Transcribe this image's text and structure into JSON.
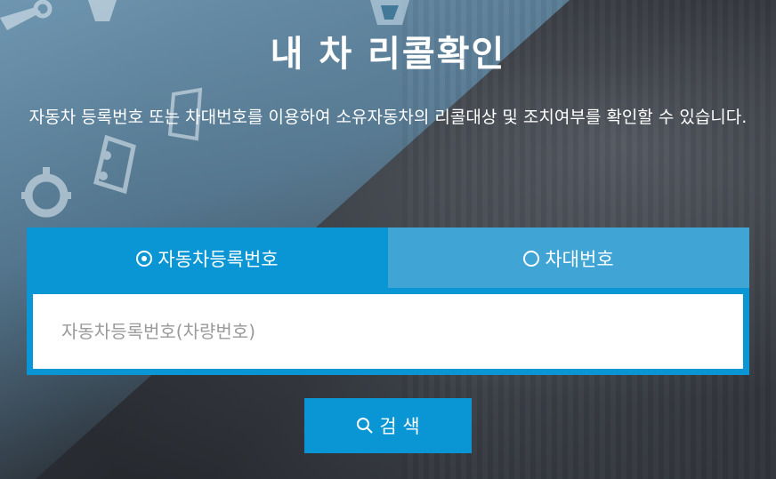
{
  "page": {
    "title": "내 차 리콜확인",
    "description": "자동차 등록번호 또는 차대번호를 이용하여 소유자동차의 리콜대상 및 조치여부를 확인할 수 있습니다."
  },
  "tabs": [
    {
      "label": "자동차등록번호",
      "selected": true
    },
    {
      "label": "차대번호",
      "selected": false
    }
  ],
  "search": {
    "placeholder": "자동차등록번호(차량번호)",
    "value": "",
    "button_label": "검 색"
  },
  "colors": {
    "accent": "#0a96d4",
    "tab_inactive": "#40a4d5",
    "text": "#ffffff"
  },
  "icons": {
    "search_button": "search-icon",
    "background": [
      "wrench-icon",
      "gear-icon",
      "car-icon"
    ]
  }
}
